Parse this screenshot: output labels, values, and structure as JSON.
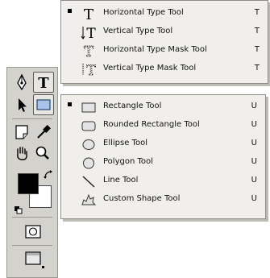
{
  "type_flyout": {
    "items": [
      {
        "label": "Horizontal Type Tool",
        "key": "T",
        "icon": "horizontal-type-icon",
        "selected": true
      },
      {
        "label": "Vertical Type Tool",
        "key": "T",
        "icon": "vertical-type-icon",
        "selected": false
      },
      {
        "label": "Horizontal Type Mask Tool",
        "key": "T",
        "icon": "horizontal-type-mask-icon",
        "selected": false
      },
      {
        "label": "Vertical Type Mask Tool",
        "key": "T",
        "icon": "vertical-type-mask-icon",
        "selected": false
      }
    ]
  },
  "shape_flyout": {
    "items": [
      {
        "label": "Rectangle Tool",
        "key": "U",
        "icon": "rectangle-icon",
        "selected": true
      },
      {
        "label": "Rounded Rectangle Tool",
        "key": "U",
        "icon": "rounded-rectangle-icon",
        "selected": false
      },
      {
        "label": "Ellipse Tool",
        "key": "U",
        "icon": "ellipse-icon",
        "selected": false
      },
      {
        "label": "Polygon Tool",
        "key": "U",
        "icon": "polygon-icon",
        "selected": false
      },
      {
        "label": "Line Tool",
        "key": "U",
        "icon": "line-icon",
        "selected": false
      },
      {
        "label": "Custom Shape Tool",
        "key": "U",
        "icon": "custom-shape-icon",
        "selected": false
      }
    ]
  },
  "toolbar": {
    "tools": [
      "pen-icon",
      "type-icon",
      "path-selection-icon",
      "rectangle-shape-icon",
      "notes-icon",
      "eyedropper-icon",
      "hand-icon",
      "zoom-icon",
      "quick-mask-icon",
      "screen-mode-icon"
    ],
    "foreground_color": "#000000",
    "background_color": "#ffffff"
  }
}
